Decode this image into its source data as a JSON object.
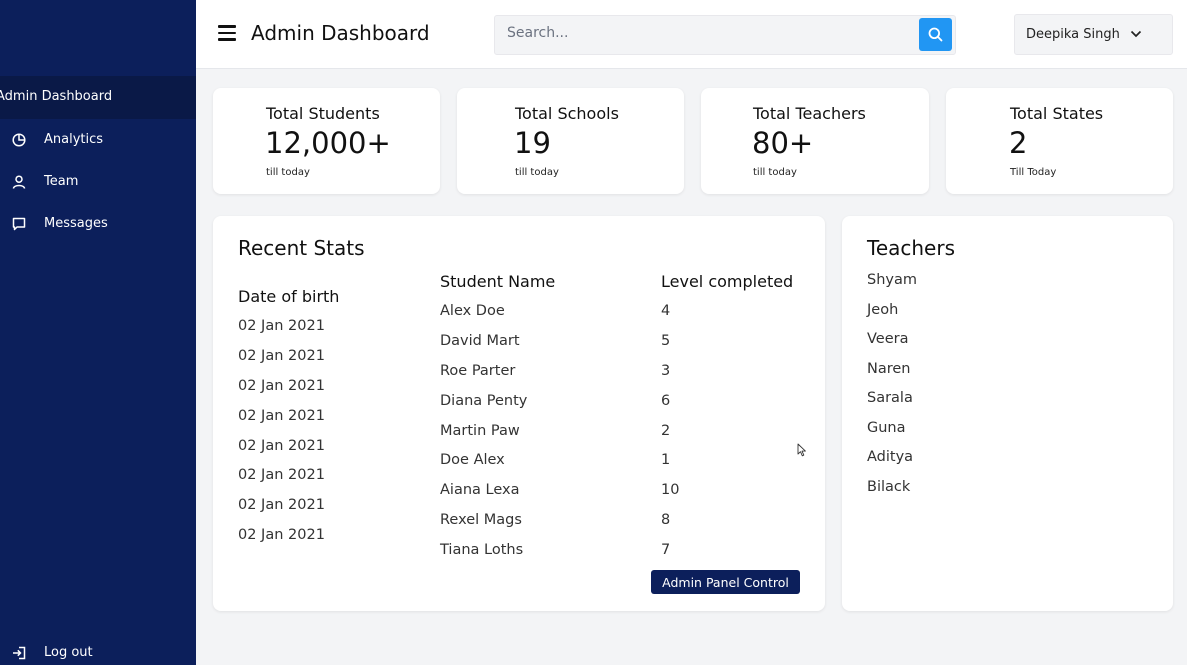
{
  "sidebar": {
    "active_label": "Admin Dashboard",
    "items": [
      {
        "label": "Analytics",
        "icon": "pie-chart-icon"
      },
      {
        "label": "Team",
        "icon": "user-icon"
      },
      {
        "label": "Messages",
        "icon": "message-icon"
      }
    ],
    "logout_label": "Log out"
  },
  "header": {
    "title": "Admin Dashboard",
    "search_placeholder": "Search...",
    "user_name": "Deepika Singh"
  },
  "stats": [
    {
      "title": "Total Students",
      "value": "12,000+",
      "sub": "till today"
    },
    {
      "title": "Total Schools",
      "value": "19",
      "sub": "till today"
    },
    {
      "title": "Total Teachers",
      "value": "80+",
      "sub": "till today"
    },
    {
      "title": "Total States",
      "value": "2",
      "sub": "Till Today"
    }
  ],
  "recent": {
    "title": "Recent Stats",
    "headers": {
      "dob": "Date of birth",
      "name": "Student Name",
      "level": "Level completed"
    },
    "dob": [
      "02 Jan 2021",
      "02 Jan 2021",
      "02 Jan 2021",
      "02 Jan 2021",
      "02 Jan 2021",
      "02 Jan 2021",
      "02 Jan 2021",
      "02 Jan 2021"
    ],
    "names": [
      "Alex Doe",
      "David Mart",
      "Roe Parter",
      "Diana Penty",
      "Martin Paw",
      "Doe Alex",
      "Aiana Lexa",
      "Rexel Mags",
      "Tiana Loths"
    ],
    "levels": [
      "4",
      "5",
      "3",
      "6",
      "2",
      "1",
      "10",
      "8",
      "7"
    ],
    "button_label": "Admin Panel Control"
  },
  "teachers": {
    "title": "Teachers",
    "names": [
      "Shyam",
      "Jeoh",
      "Veera",
      "Naren",
      "Sarala",
      "Guna",
      "Aditya",
      "Bilack"
    ]
  },
  "colors": {
    "sidebar": "#0c1f5b",
    "accent": "#2196f3",
    "background": "#f3f4f6"
  }
}
